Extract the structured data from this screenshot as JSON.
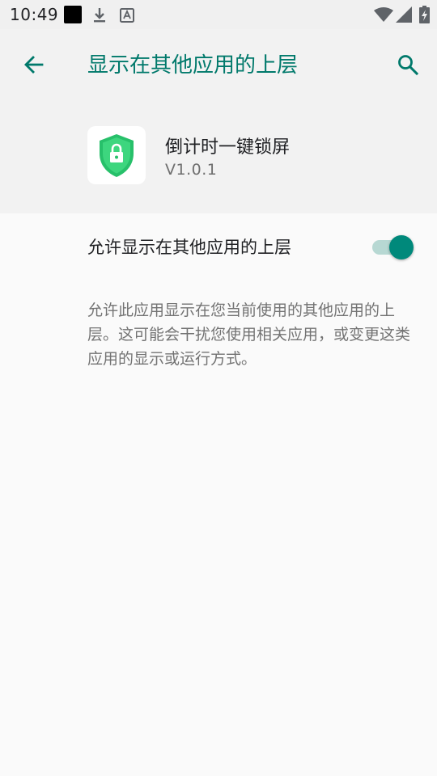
{
  "status_bar": {
    "time": "10:49",
    "icons": [
      "notification-square-icon",
      "download-icon",
      "font-a-icon",
      "wifi-icon",
      "signal-icon",
      "battery-charging-icon"
    ]
  },
  "app_bar": {
    "title": "显示在其他应用的上层",
    "back_icon": "arrow-left-icon",
    "search_icon": "search-icon"
  },
  "app_info": {
    "name": "倒计时一键锁屏",
    "version": "V1.0.1",
    "icon": "shield-lock-icon"
  },
  "setting": {
    "label": "允许显示在其他应用的上层",
    "toggle_on": true
  },
  "description": "允许此应用显示在您当前使用的其他应用的上层。这可能会干扰您使用相关应用，或变更这类应用的显示或运行方式。",
  "colors": {
    "accent": "#00796b",
    "toggle_thumb": "#00897b",
    "toggle_track": "#b7d8d3",
    "shield_green": "#2ecc71"
  }
}
